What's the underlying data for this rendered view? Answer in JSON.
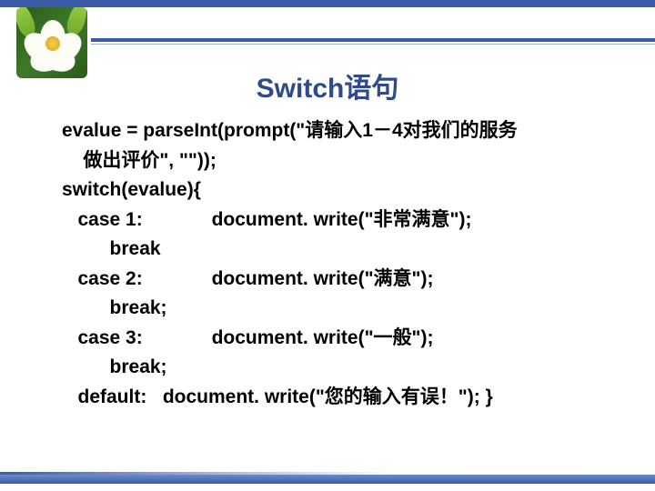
{
  "title": "Switch语句",
  "code": {
    "l1": "evalue = parseInt(prompt(\"请输入1－4对我们的服务",
    "l2": "    做出评价\", \"\"));",
    "l3": "switch(evalue){",
    "l4": "   case 1:             document. write(\"非常满意\");",
    "l5": "         break",
    "l6": "   case 2:             document. write(\"满意\");",
    "l7": "         break;",
    "l8": "   case 3:             document. write(\"一般\");",
    "l9": "         break;",
    "l10": "   default:   document. write(\"您的输入有误！\"); }"
  }
}
